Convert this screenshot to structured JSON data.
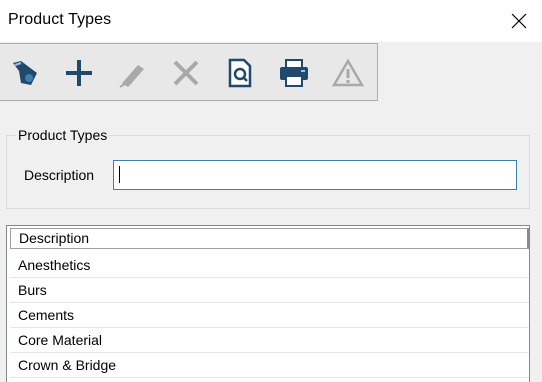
{
  "window": {
    "title": "Product Types",
    "close_icon": "close-icon"
  },
  "toolbar": {
    "buttons": [
      {
        "name": "search-records",
        "icon": "binoculars-icon"
      },
      {
        "name": "add",
        "icon": "plus-icon"
      },
      {
        "name": "edit",
        "icon": "pencil-icon"
      },
      {
        "name": "delete",
        "icon": "x-icon"
      },
      {
        "name": "preview",
        "icon": "document-magnifier-icon"
      },
      {
        "name": "print",
        "icon": "printer-icon"
      },
      {
        "name": "warning",
        "icon": "warning-icon"
      }
    ]
  },
  "form": {
    "group_title": "Product Types",
    "description_label": "Description",
    "description_value": ""
  },
  "grid": {
    "columns": [
      "Description"
    ],
    "rows": [
      "Anesthetics",
      "Burs",
      "Cements",
      "Core Material",
      "Crown & Bridge"
    ]
  },
  "colors": {
    "titlebar": "#ffffff",
    "background": "#f0f0f0",
    "toolbar": "#e8e8e8",
    "accent_input_border": "#3c7fb1",
    "icon_dark": "#1f4a6e",
    "icon_disabled": "#a9a9a9"
  }
}
